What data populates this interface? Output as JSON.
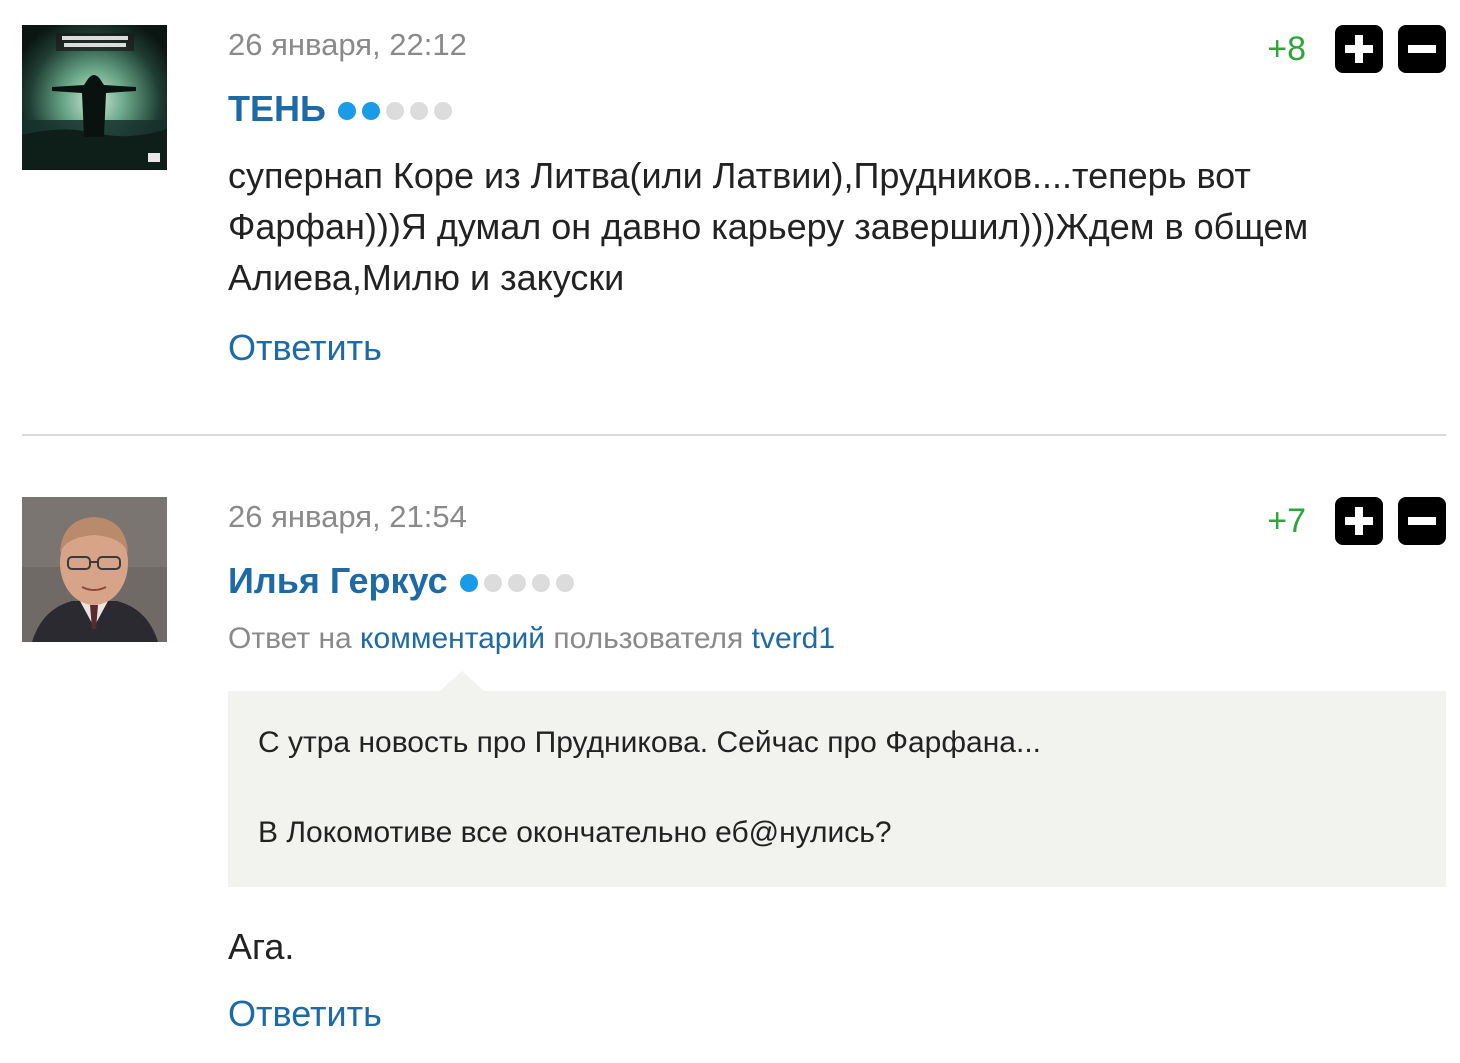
{
  "comments": [
    {
      "date": "26 января, 22:12",
      "author": "ТЕНЬ",
      "rank_dots": [
        true,
        true,
        false,
        false,
        false
      ],
      "score": "+8",
      "text": "супернап Коре из Литва(или Латвии),Прудников....теперь вот Фарфан)))Я думал он давно карьеру завершил)))Ждем в общем Алиева,Милю и закуски",
      "reply_label": "Ответить",
      "avatar_icon": "album-cover-figure-icon"
    },
    {
      "date": "26 января, 21:54",
      "author": "Илья Геркус",
      "rank_dots": [
        true,
        false,
        false,
        false,
        false
      ],
      "score": "+7",
      "reply_to": {
        "prefix": "Ответ на",
        "link": "комментарий",
        "middle": "пользователя",
        "user": "tverd1"
      },
      "quote_lines": [
        "С утра новость про Прудникова. Сейчас про Фарфана...",
        "В Локомотиве все окончательно еб@нулись?"
      ],
      "text": "Ага.",
      "reply_label": "Ответить",
      "avatar_icon": "user-photo-icon"
    }
  ],
  "vote_icons": {
    "up": "plus-icon",
    "down": "minus-icon"
  },
  "colors": {
    "author": "#1d6aa5",
    "score_positive": "#2ea43a",
    "rank_active": "#1a9be6",
    "rank_inactive": "#dcdcdc",
    "quote_bg": "#f2f2ef",
    "meta_text": "#8a8a8a"
  }
}
